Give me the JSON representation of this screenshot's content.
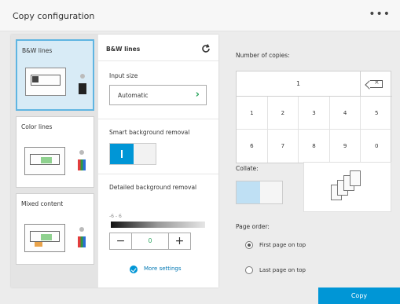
{
  "header": {
    "title": "Copy configuration",
    "menu_glyph": "•••"
  },
  "presets": [
    {
      "label": "B&W lines",
      "selected": true,
      "type": "bw"
    },
    {
      "label": "Color lines",
      "selected": false,
      "type": "color"
    },
    {
      "label": "Mixed content",
      "selected": false,
      "type": "mixed"
    }
  ],
  "settings": {
    "title": "B&W lines",
    "input_size": {
      "label": "Input size",
      "value": "Automatic"
    },
    "smart_bg": {
      "label": "Smart background removal",
      "state": "on"
    },
    "detailed_bg": {
      "label": "Detailed background removal",
      "range": "-6 - 6",
      "value": "0",
      "minus": "−",
      "plus": "+"
    },
    "more_settings": "More settings"
  },
  "copies": {
    "label": "Number of copies:",
    "value": "1",
    "keys": [
      "1",
      "2",
      "3",
      "4",
      "5",
      "6",
      "7",
      "8",
      "9",
      "0"
    ]
  },
  "collate": {
    "label": "Collate:",
    "state": "on"
  },
  "page_order": {
    "label": "Page order:",
    "options": [
      {
        "label": "First page on top",
        "checked": true
      },
      {
        "label": "Last page on top",
        "checked": false
      }
    ]
  },
  "actions": {
    "copy": "Copy"
  },
  "colors": {
    "accent": "#0096d6",
    "chevron": "#2aa55d",
    "selected_bg": "#d8ebf6"
  }
}
